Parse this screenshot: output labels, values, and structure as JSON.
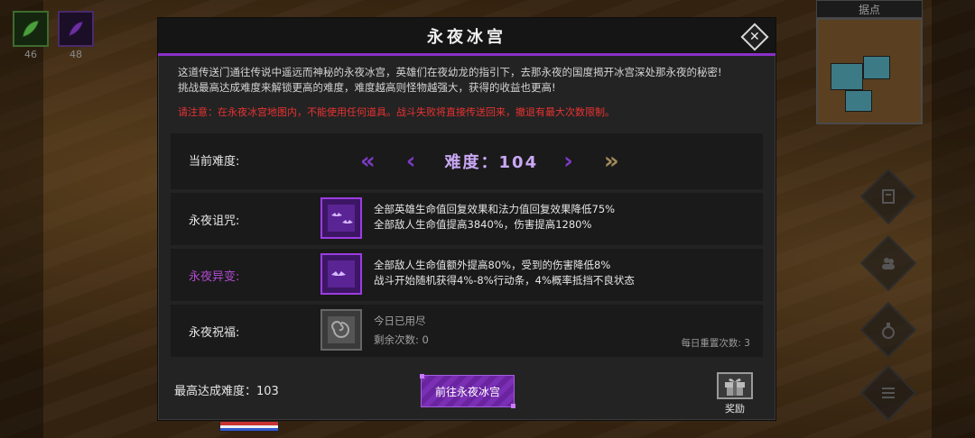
{
  "hud": {
    "slots": [
      {
        "count": "46",
        "icon": "green-leaf-icon"
      },
      {
        "count": "48",
        "icon": "purple-feather-icon"
      }
    ],
    "minimap_title": "据点",
    "side_buttons": [
      "quest-scroll-icon",
      "party-icon",
      "potion-icon",
      "list-menu-icon"
    ]
  },
  "modal": {
    "title": "永夜冰宫",
    "description": [
      "这道传送门通往传说中遥远而神秘的永夜冰宫，英雄们在夜幼龙的指引下，去那永夜的国度揭开冰宫深处那永夜的秘密!",
      "挑战最高达成难度来解锁更高的难度，难度越高则怪物越强大，获得的收益也更高!"
    ],
    "warning": "请注意：在永夜冰宫地图内，不能使用任何道具。战斗失败将直接传送回来，撤退有最大次数限制。",
    "difficulty": {
      "label": "当前难度:",
      "value_text": "难度：104",
      "value": 104,
      "first_arrow": "«",
      "prev_arrow": "‹",
      "next_arrow": "›",
      "last_arrow": "»"
    },
    "curse": {
      "label": "永夜诅咒:",
      "lines": [
        "全部英雄生命值回复效果和法力值回复效果降低75%",
        "全部敌人生命值提高3840%，伤害提高1280%"
      ]
    },
    "mutation": {
      "label": "永夜异变:",
      "lines": [
        "全部敌人生命值额外提高80%，受到的伤害降低8%",
        "战斗开始随机获得4%-8%行动条，4%概率抵挡不良状态"
      ]
    },
    "blessing": {
      "label": "永夜祝福:",
      "lines": [
        "今日已用尽",
        "剩余次数: 0"
      ],
      "reset_text": "每日重置次数: 3"
    },
    "footer": {
      "best_text": "最高达成难度：103",
      "go_button": "前往永夜冰宫",
      "reward_label": "奖励"
    }
  },
  "colors": {
    "accent_purple": "#8b2fc9",
    "warning_red": "#e83232",
    "panel_bg": "#1a1a1a"
  }
}
